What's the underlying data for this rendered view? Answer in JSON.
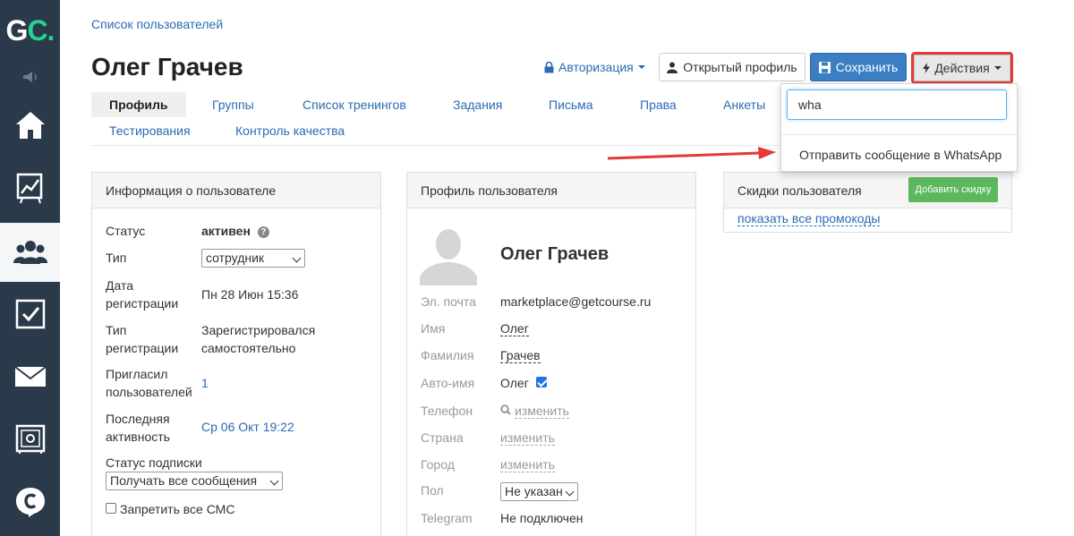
{
  "sidebar": {
    "logo_g": "G",
    "logo_c": "C",
    "logo_dot": ".",
    "items": [
      {
        "name": "home",
        "icon": "home-icon"
      },
      {
        "name": "reports",
        "icon": "chart-icon"
      },
      {
        "name": "users",
        "icon": "users-icon",
        "active": true
      },
      {
        "name": "tasks",
        "icon": "checkbox-icon"
      },
      {
        "name": "mail",
        "icon": "mail-icon"
      },
      {
        "name": "safe",
        "icon": "safe-icon"
      },
      {
        "name": "chat",
        "icon": "chat-logo-icon"
      }
    ]
  },
  "header": {
    "breadcrumb": "Список пользователей",
    "title": "Олег Грачев",
    "auth_link": "Авторизация",
    "open_profile": "Открытый профиль",
    "save": "Сохранить",
    "actions": "Действия"
  },
  "tabs": [
    {
      "label": "Профиль",
      "active": true
    },
    {
      "label": "Группы"
    },
    {
      "label": "Список тренингов"
    },
    {
      "label": "Задания"
    },
    {
      "label": "Письма"
    },
    {
      "label": "Права"
    },
    {
      "label": "Анкеты"
    },
    {
      "label": "Тестирования"
    },
    {
      "label": "Контроль качества"
    }
  ],
  "dropdown": {
    "search_value": "wha",
    "item": "Отправить сообщение в WhatsApp"
  },
  "user_info": {
    "title": "Информация о пользователе",
    "status_label": "Статус",
    "status_value": "активен",
    "type_label": "Тип",
    "type_value": "сотрудник",
    "reg_date_label_1": "Дата",
    "reg_date_label_2": "регистрации",
    "reg_date_value": "Пн 28 Июн 15:36",
    "reg_type_label_1": "Тип",
    "reg_type_label_2": "регистрации",
    "reg_type_value_1": "Зарегистрировался",
    "reg_type_value_2": "самостоятельно",
    "invited_label_1": "Пригласил",
    "invited_label_2": "пользователей",
    "invited_value": "1",
    "last_active_label_1": "Последняя",
    "last_active_label_2": "активность",
    "last_active_value": "Ср 06 Окт 19:22",
    "subscription_label": "Статус подписки",
    "subscription_value": "Получать все сообщения",
    "sms_label": "Запретить все СМС"
  },
  "user_profile": {
    "title": "Профиль пользователя",
    "name": "Олег Грачев",
    "email_label": "Эл. почта",
    "email_value": "marketplace@getcourse.ru",
    "first_name_label": "Имя",
    "first_name_value": "Олег",
    "last_name_label": "Фамилия",
    "last_name_value": "Грачев",
    "auto_name_label": "Авто-имя",
    "auto_name_value": "Олег",
    "phone_label": "Телефон",
    "phone_value": "изменить",
    "country_label": "Страна",
    "country_value": "изменить",
    "city_label": "Город",
    "city_value": "изменить",
    "gender_label": "Пол",
    "gender_value": "Не указан",
    "telegram_label": "Telegram",
    "telegram_value": "Не подключен"
  },
  "discounts": {
    "title": "Скидки пользователя",
    "add_button": "Добавить скидку",
    "promo_link": "показать все промокоды"
  },
  "colors": {
    "sidebar_bg": "#2b3a4a",
    "link": "#2a6bb3",
    "primary_button": "#3b7ec2",
    "success_button": "#5cb85c",
    "highlight": "#e53935"
  }
}
